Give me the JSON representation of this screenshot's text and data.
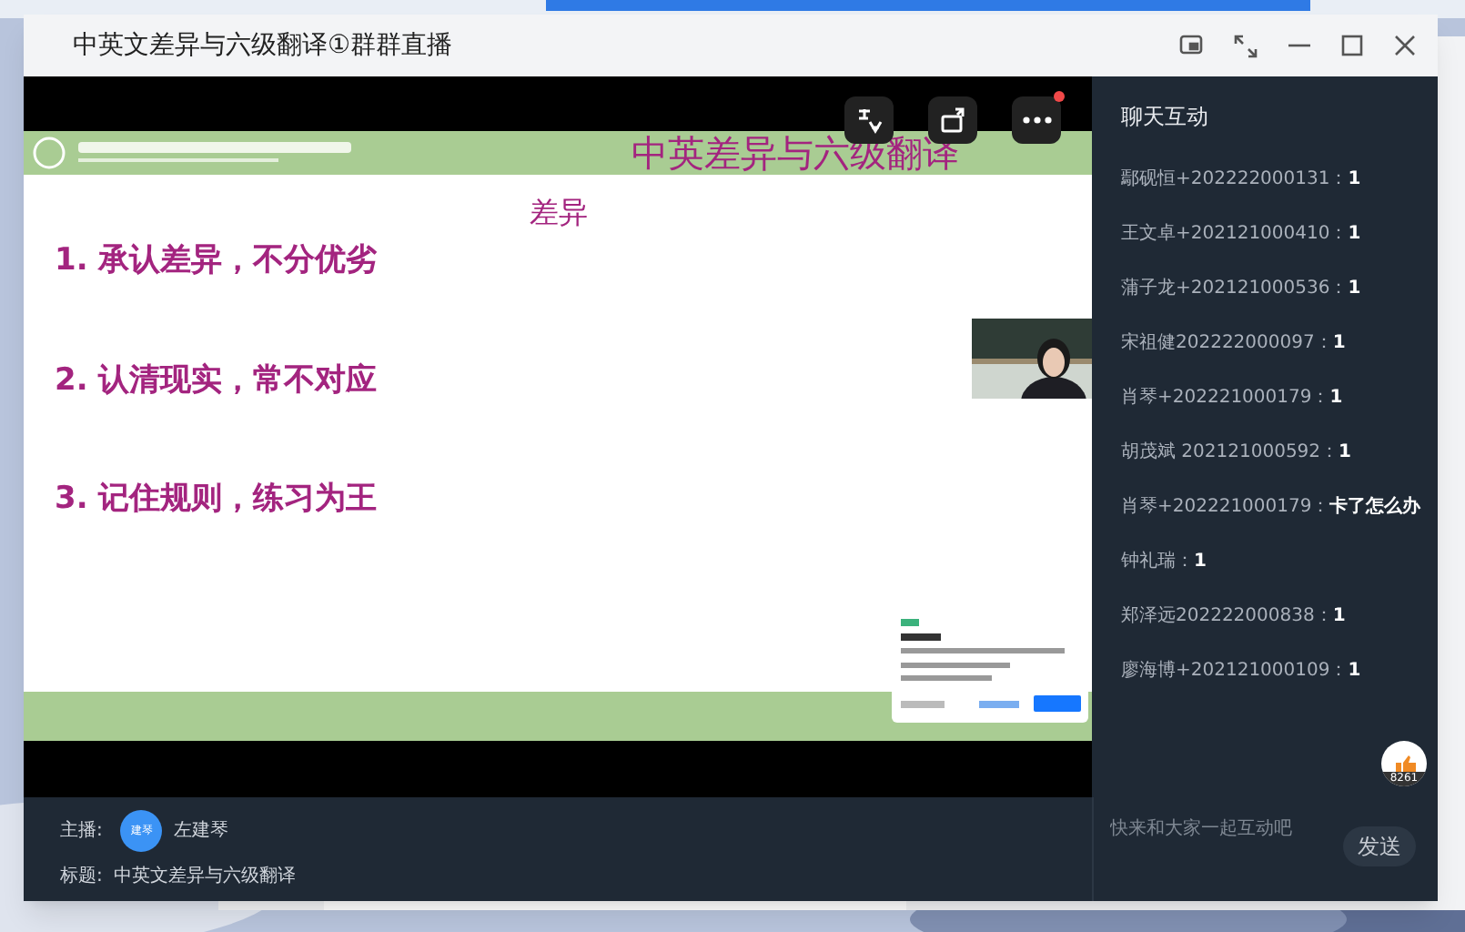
{
  "window": {
    "title": "中英文差异与六级翻译①群群直播"
  },
  "slide": {
    "header": "中英差异与六级翻译",
    "subtitle": "差异",
    "points": [
      "1. 承认差异，不分优劣",
      "2. 认清现实，常不对应",
      "3. 记住规则，练习为王"
    ]
  },
  "video_controls": [
    {
      "kind": "translate",
      "badge": false
    },
    {
      "kind": "rotate",
      "badge": false
    },
    {
      "kind": "more",
      "badge": true
    }
  ],
  "chat": {
    "title": "聊天互动",
    "messages": [
      {
        "sender": "鄢砚恒+202222000131：",
        "text": "1"
      },
      {
        "sender": "王文卓+202121000410：",
        "text": "1"
      },
      {
        "sender": "蒲子龙+202121000536：",
        "text": "1"
      },
      {
        "sender": "宋祖健202222000097：",
        "text": "1"
      },
      {
        "sender": "肖琴+202221000179：",
        "text": "1"
      },
      {
        "sender": "胡茂斌 202121000592：",
        "text": "1"
      },
      {
        "sender": "肖琴+202221000179：",
        "text": "卡了怎么办"
      },
      {
        "sender": "钟礼瑞：",
        "text": "1"
      },
      {
        "sender": "郑泽远202222000838：",
        "text": "1"
      },
      {
        "sender": "廖海博+202121000109：",
        "text": "1"
      }
    ],
    "likes": "8261",
    "placeholder": "快来和大家一起互动吧",
    "send": "发送"
  },
  "info": {
    "host_label": "主播:",
    "avatar": "建琴",
    "host": "左建琴",
    "title_label": "标题:",
    "title": "中英文差异与六级翻译"
  }
}
